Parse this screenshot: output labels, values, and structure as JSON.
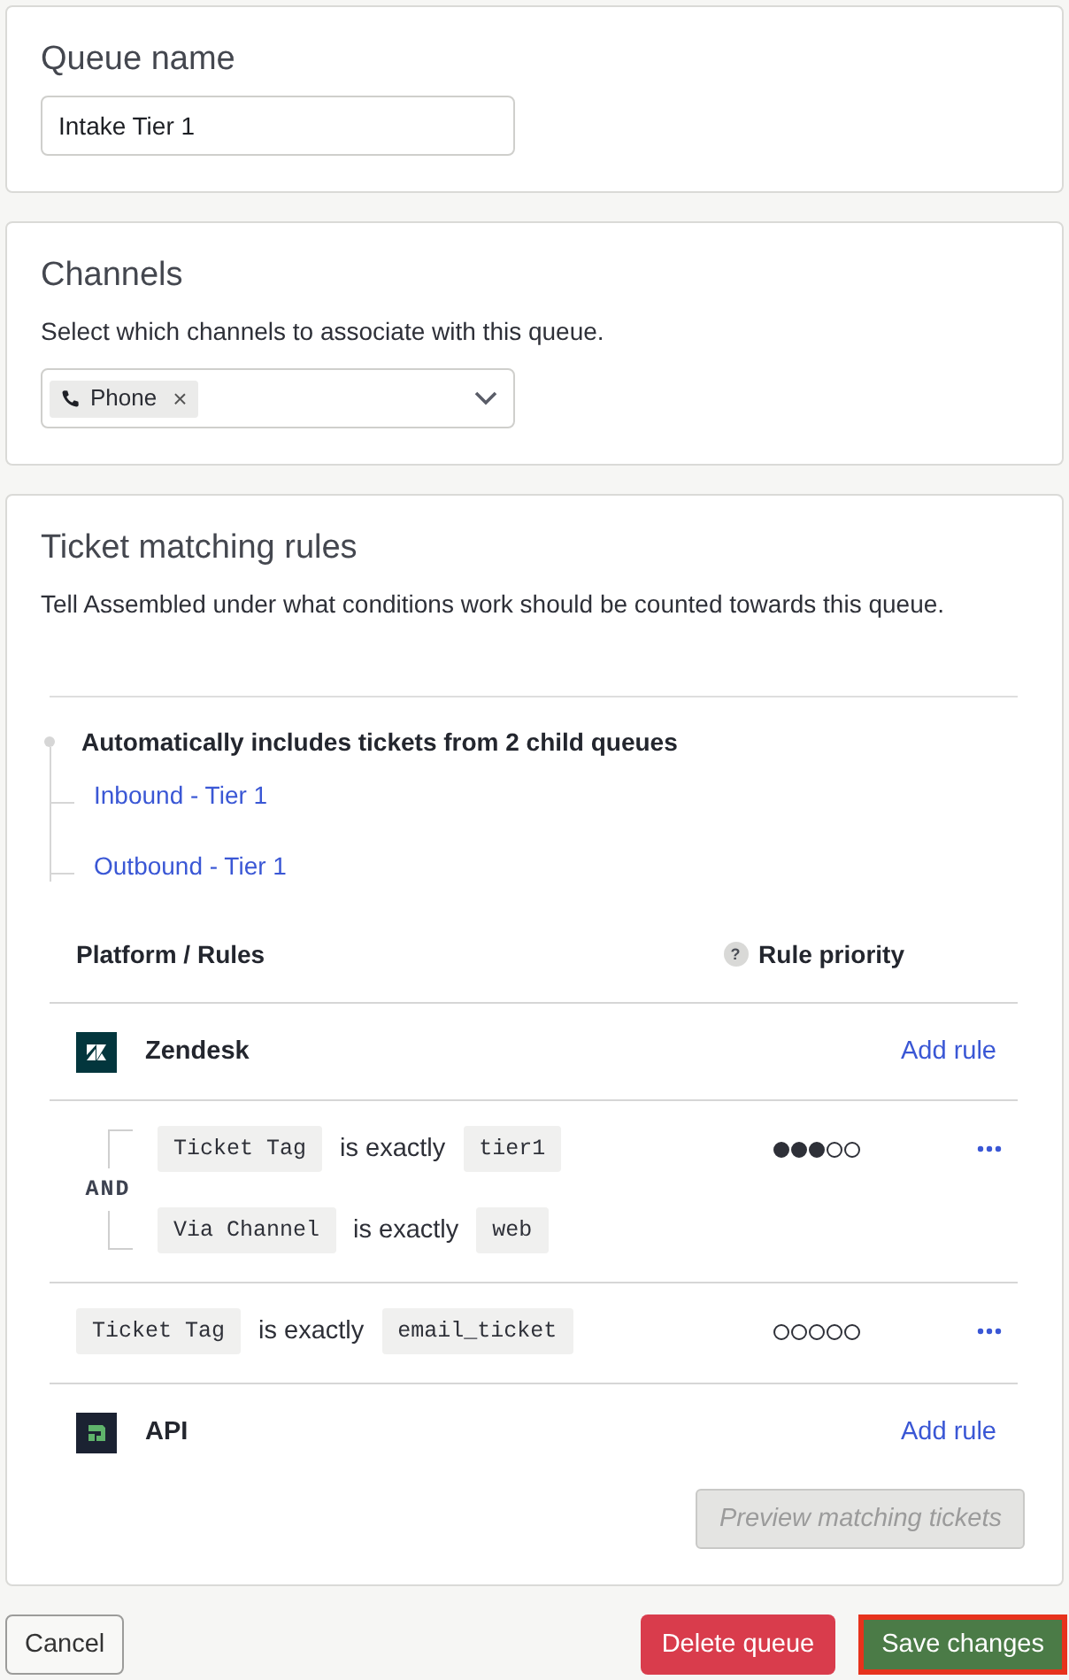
{
  "queue_name": {
    "title": "Queue name",
    "value": "Intake Tier 1"
  },
  "channels": {
    "title": "Channels",
    "description": "Select which channels to associate with this queue.",
    "selected_tags": [
      {
        "label": "Phone",
        "remove": "×"
      }
    ]
  },
  "matching_rules": {
    "title": "Ticket matching rules",
    "description": "Tell Assembled under what conditions work should be counted towards this queue.",
    "child_queues": {
      "heading": "Automatically includes tickets from 2 child queues",
      "items": [
        {
          "label": "Inbound - Tier 1"
        },
        {
          "label": "Outbound - Tier 1"
        }
      ]
    },
    "table": {
      "columns": [
        {
          "label": "Platform / Rules"
        },
        {
          "label": "Rule priority",
          "help": "?"
        }
      ],
      "platforms": [
        {
          "name": "Zendesk",
          "kind": "zendesk",
          "action": "Add rule",
          "rules": [
            {
              "kind": "group",
              "operator": "AND",
              "stars": 3,
              "conditions": [
                {
                  "field": "Ticket Tag",
                  "operator": "is exactly",
                  "value": "tier1"
                },
                {
                  "field": "Via Channel",
                  "operator": "is exactly",
                  "value": "web"
                }
              ]
            },
            {
              "kind": "single",
              "stars": 0,
              "conditions": [
                {
                  "field": "Ticket Tag",
                  "operator": "is exactly",
                  "value": "email_ticket"
                }
              ]
            }
          ]
        },
        {
          "name": "API",
          "kind": "api",
          "action": "Add rule"
        }
      ]
    },
    "preview_button": {
      "label": "Preview matching tickets",
      "disabled": true
    }
  },
  "footer": {
    "buttons": [
      {
        "label": "Cancel",
        "kind": "secondary",
        "highlighted": false
      },
      {
        "label": "Delete queue",
        "kind": "danger",
        "highlighted": false
      },
      {
        "label": "Save changes",
        "kind": "primary",
        "highlighted": true
      }
    ]
  }
}
